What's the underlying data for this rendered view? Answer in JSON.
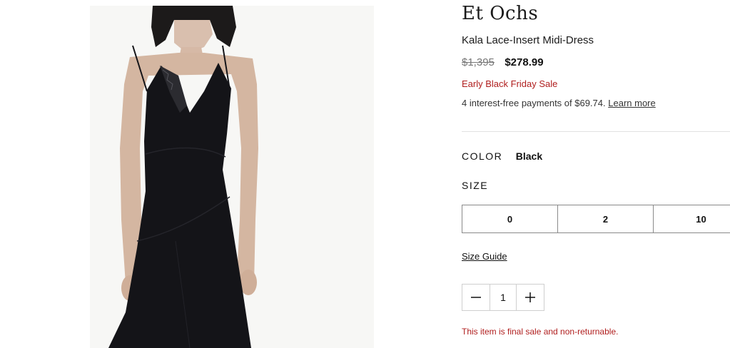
{
  "product": {
    "brand": "Et Ochs",
    "name": "Kala Lace-Insert Midi-Dress",
    "original_price": "$1,395",
    "sale_price": "$278.99",
    "promo": "Early Black Friday Sale",
    "installments_text": "4 interest-free payments of $69.74.",
    "learn_more": "Learn more",
    "color_label": "COLOR",
    "color_value": "Black",
    "size_label": "SIZE",
    "sizes": [
      "0",
      "2",
      "10"
    ],
    "size_guide": "Size Guide",
    "quantity": "1",
    "final_sale_notice": "This item is final sale and non-returnable."
  },
  "colors": {
    "sale_red": "#b01e1e",
    "dress": "#141418",
    "border": "#8a8a8a"
  },
  "icons": {
    "decrement": "minus-icon",
    "increment": "plus-icon"
  }
}
